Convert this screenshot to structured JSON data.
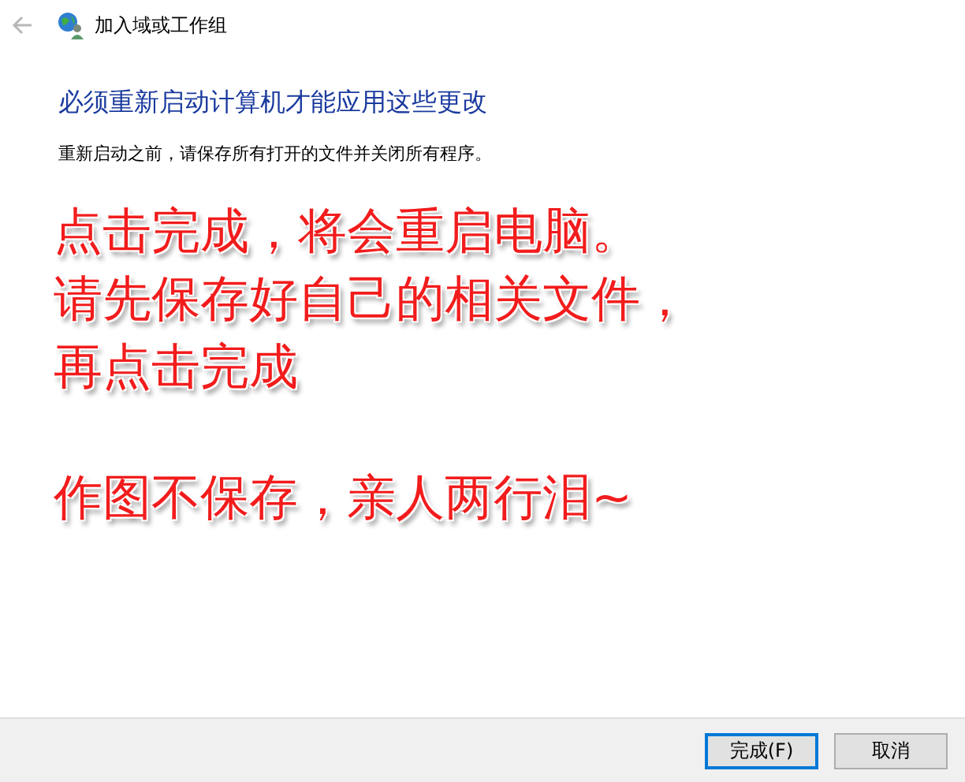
{
  "window": {
    "title": "加入域或工作组"
  },
  "heading": "必须重新启动计算机才能应用这些更改",
  "message": "重新启动之前，请保存所有打开的文件并关闭所有程序。",
  "annotations": [
    {
      "lines": [
        "点击完成，将会重启电脑。",
        "请先保存好自己的相关文件，",
        "再点击完成"
      ]
    },
    {
      "lines": [
        "作图不保存，亲人两行泪~"
      ]
    }
  ],
  "buttons": [
    {
      "label": "完成(F)",
      "default": true
    },
    {
      "label": "取消",
      "default": false
    }
  ]
}
